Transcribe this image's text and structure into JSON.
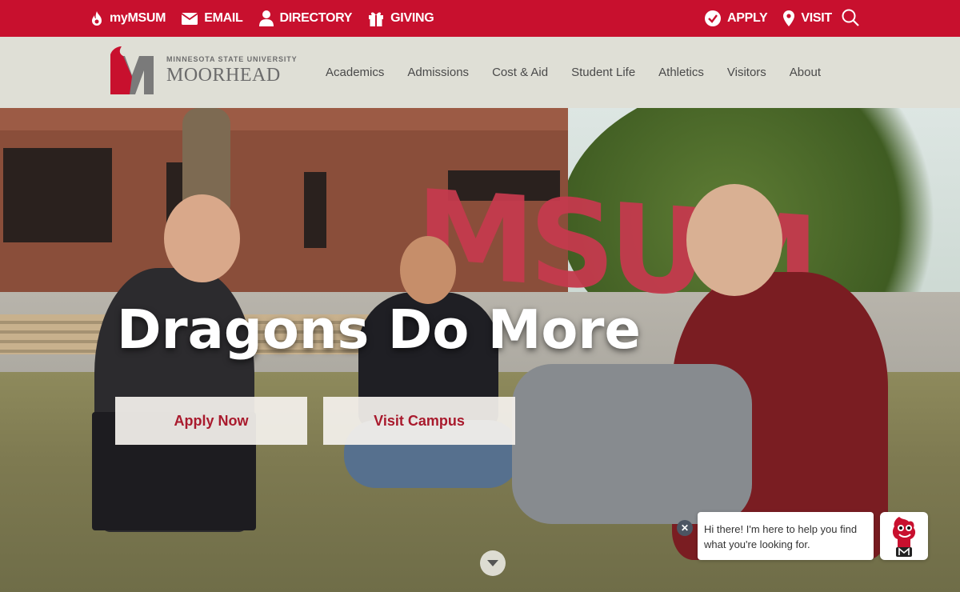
{
  "utility_bar": {
    "mymsum": "myMSUM",
    "email": "EMAIL",
    "directory": "DIRECTORY",
    "giving": "GIVING",
    "apply": "APPLY",
    "visit": "VISIT",
    "icons": [
      "flame-icon",
      "envelope-icon",
      "person-icon",
      "gift-icon",
      "checkmark-circle-icon",
      "map-pin-icon",
      "search-icon"
    ],
    "background_color": "#c8102e"
  },
  "logo": {
    "top_line": "MINNESOTA STATE UNIVERSITY",
    "bottom_line": "MOORHEAD"
  },
  "nav": {
    "items": [
      {
        "label": "Academics"
      },
      {
        "label": "Admissions"
      },
      {
        "label": "Cost & Aid"
      },
      {
        "label": "Student Life"
      },
      {
        "label": "Athletics"
      },
      {
        "label": "Visitors"
      },
      {
        "label": "About"
      }
    ]
  },
  "hero": {
    "title": "Dragons Do More",
    "apply_button": "Apply Now",
    "visit_button": "Visit Campus",
    "scene_sign_text": "MSUM"
  },
  "chat": {
    "message": "Hi there! I'm here to help you find what you're looking for.",
    "close_glyph": "✕"
  },
  "colors": {
    "brand_red": "#c8102e",
    "button_text": "#a91a2d"
  }
}
